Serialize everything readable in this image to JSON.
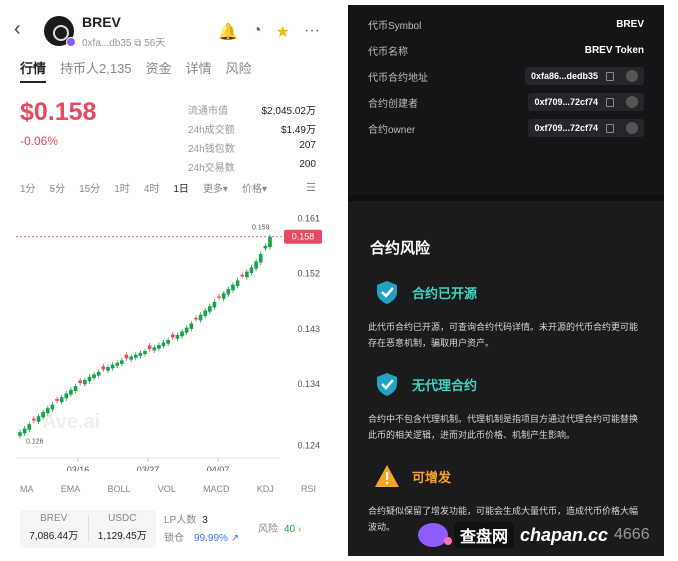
{
  "token": {
    "name": "BREV",
    "address_short": "0xfa...db35",
    "age": "56天"
  },
  "header_icons": [
    "bell-icon",
    "gauge-icon",
    "star-icon",
    "more-icon"
  ],
  "tabs": [
    {
      "label": "行情",
      "active": true
    },
    {
      "label": "持币人2,135",
      "active": false
    },
    {
      "label": "资金",
      "active": false
    },
    {
      "label": "详情",
      "active": false
    },
    {
      "label": "风险",
      "active": false
    }
  ],
  "price": "$0.158",
  "change": "-0.06%",
  "stats": [
    {
      "label": "流通市值",
      "value": "$2,045.02万"
    },
    {
      "label": "24h成交额",
      "value": "$1.49万"
    },
    {
      "label": "24h钱包数",
      "value": "207"
    },
    {
      "label": "24h交易数",
      "value": "200"
    }
  ],
  "timeframes": [
    {
      "label": "1分",
      "active": false
    },
    {
      "label": "5分",
      "active": false
    },
    {
      "label": "15分",
      "active": false
    },
    {
      "label": "1时",
      "active": false
    },
    {
      "label": "4时",
      "active": false
    },
    {
      "label": "1日",
      "active": true
    },
    {
      "label": "更多▾",
      "active": false
    },
    {
      "label": "价格▾",
      "active": false
    }
  ],
  "chart_data": {
    "type": "candlestick",
    "y_ticks": [
      "0.161",
      "0.152",
      "0.143",
      "0.134",
      "0.124"
    ],
    "x_ticks": [
      "03/16",
      "03/27",
      "04/07"
    ],
    "current_price_label": "0.158",
    "high_label": "0.159",
    "low_label": "0.126",
    "watermark": "Ave.ai",
    "ylim": [
      0.122,
      0.163
    ],
    "closes": [
      0.1262,
      0.1268,
      0.1275,
      0.1281,
      0.1288,
      0.1295,
      0.1301,
      0.1307,
      0.1313,
      0.1319,
      0.1325,
      0.1331,
      0.1337,
      0.1342,
      0.1347,
      0.1352,
      0.1356,
      0.136,
      0.1364,
      0.1368,
      0.1372,
      0.1375,
      0.1379,
      0.1382,
      0.1385,
      0.1388,
      0.1391,
      0.1394,
      0.1397,
      0.14,
      0.1404,
      0.1408,
      0.1412,
      0.1416,
      0.142,
      0.1426,
      0.1432,
      0.1439,
      0.1446,
      0.1453,
      0.146,
      0.1467,
      0.1474,
      0.1481,
      0.1488,
      0.1495,
      0.1502,
      0.1509,
      0.1516,
      0.1523,
      0.153,
      0.154,
      0.1552,
      0.1565,
      0.158
    ]
  },
  "indicators": [
    "MA",
    "EMA",
    "BOLL",
    "VOL",
    "MACD",
    "KDJ",
    "RSI"
  ],
  "pool": [
    {
      "name": "BREV",
      "amount": "7,086.44万"
    },
    {
      "name": "USDC",
      "amount": "1,129.45万"
    }
  ],
  "lp": {
    "label": "LP人数",
    "count": "3",
    "lock_label": "锁仓",
    "lock_value": "99.99%"
  },
  "risk_summary": {
    "label": "风险",
    "count": "40"
  },
  "contract_info": [
    {
      "label": "代币Symbol",
      "value": "BREV",
      "pill": false
    },
    {
      "label": "代币名称",
      "value": "BREV Token",
      "pill": false
    },
    {
      "label": "代币合约地址",
      "value": "0xfa86...dedb35",
      "pill": true
    },
    {
      "label": "合约创建者",
      "value": "0xf709...72cf74",
      "pill": true
    },
    {
      "label": "合约owner",
      "value": "0xf709...72cf74",
      "pill": true
    }
  ],
  "contract_risk": {
    "title": "合约风险",
    "items": [
      {
        "title": "合约已开源",
        "desc": "此代币合约已开源，可查询合约代码详情。未开源的代币合约更可能存在恶意机制，骗取用户资产。",
        "level": "safe"
      },
      {
        "title": "无代理合约",
        "desc": "合约中不包含代理机制。代理机制是指项目方通过代理合约可能替换此币的相关逻辑，进而对此币价格、机制产生影响。",
        "level": "safe"
      },
      {
        "title": "可增发",
        "desc": "合约疑似保留了增发功能，可能会生成大量代币，造成代币价格大幅波动。",
        "level": "warn"
      }
    ]
  },
  "watermark": {
    "cn": "查盘网",
    "en": "chapan.cc",
    "num": "4666"
  },
  "colors": {
    "up": "#16a34a",
    "down": "#e8495c",
    "safe": "#3dd6c0",
    "warn": "#f5a524",
    "price_tag": "#e8495c"
  }
}
